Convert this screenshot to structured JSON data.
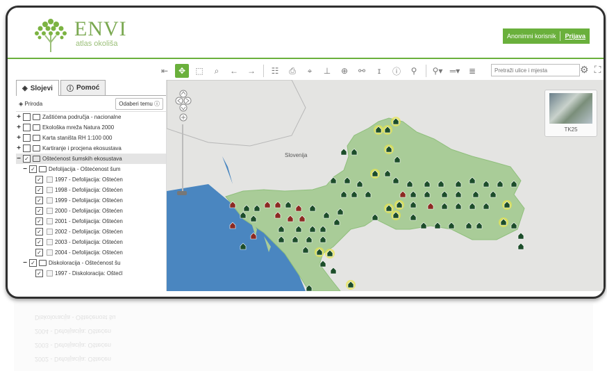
{
  "header": {
    "logo_title": "ENVI",
    "logo_subtitle": "atlas okoliša",
    "user_label": "Anonimni korisnik",
    "login_label": "Prijava"
  },
  "toolbar": {
    "search_placeholder": "Pretraži ulice i mjesta",
    "icons": [
      "exit-icon",
      "pan-icon",
      "zoom-box-icon",
      "identify-icon",
      "back-icon",
      "forward-icon",
      "legend-icon",
      "print-icon",
      "gps-icon",
      "hierarchy-icon",
      "globe-icon",
      "link-icon",
      "info-popup-icon",
      "info-icon",
      "search-icon",
      "marker-icon",
      "line-icon",
      "stack-icon",
      "settings-icon",
      "fullscreen-icon"
    ]
  },
  "sidebar": {
    "tabs": [
      {
        "label": "Slojevi",
        "icon": "layers-icon",
        "active": true
      },
      {
        "label": "Pomoć",
        "icon": "help-icon",
        "active": false
      }
    ],
    "theme_name": "Priroda",
    "theme_button": "Odaberi temu",
    "tree": [
      {
        "level": 0,
        "expander": "+",
        "checked": false,
        "label": "Zaštićena područja - nacionalne",
        "highlight": false
      },
      {
        "level": 0,
        "expander": "+",
        "checked": false,
        "label": "Ekološka mreža Natura 2000",
        "highlight": false
      },
      {
        "level": 0,
        "expander": "+",
        "checked": false,
        "label": "Karta staništa RH 1:100 000",
        "highlight": false
      },
      {
        "level": 0,
        "expander": "+",
        "checked": false,
        "label": "Kartiranje i procjena ekosustava",
        "highlight": false
      },
      {
        "level": 0,
        "expander": "−",
        "checked": true,
        "label": "Oštećenost šumskih ekosustava",
        "highlight": true
      },
      {
        "level": 1,
        "expander": "−",
        "checked": true,
        "label": "Defolijacija - Oštećenost šum",
        "highlight": false
      },
      {
        "level": 2,
        "expander": "",
        "checked": true,
        "label": "1997 - Defolijacija: Oštećen",
        "highlight": false
      },
      {
        "level": 2,
        "expander": "",
        "checked": true,
        "label": "1998 - Defolijacija: Oštećen",
        "highlight": false
      },
      {
        "level": 2,
        "expander": "",
        "checked": true,
        "label": "1999 - Defolijacija: Oštećen",
        "highlight": false
      },
      {
        "level": 2,
        "expander": "",
        "checked": true,
        "label": "2000 - Defolijacija: Oštećen",
        "highlight": false
      },
      {
        "level": 2,
        "expander": "",
        "checked": true,
        "label": "2001 - Defolijacija: Oštećen",
        "highlight": false
      },
      {
        "level": 2,
        "expander": "",
        "checked": true,
        "label": "2002 - Defolijacija: Oštećen",
        "highlight": false
      },
      {
        "level": 2,
        "expander": "",
        "checked": true,
        "label": "2003 - Defolijacija: Oštećen",
        "highlight": false
      },
      {
        "level": 2,
        "expander": "",
        "checked": true,
        "label": "2004 - Defolijacija: Oštećen",
        "highlight": false
      },
      {
        "level": 1,
        "expander": "−",
        "checked": true,
        "label": "Diskoloracija - Oštećenost šu",
        "highlight": false
      },
      {
        "level": 2,
        "expander": "",
        "checked": true,
        "label": "1997 - Diskoloracija: Oštećl",
        "highlight": false
      }
    ]
  },
  "map": {
    "country_label": "Slovenija",
    "thumbnail_label": "TK25",
    "colors": {
      "sea": "#4a86c0",
      "land": "#a9cc98",
      "other_land": "#e4e4e2",
      "marker_dark": "#1c4d2a",
      "marker_red": "#8b2a22",
      "halo": "#e8e54a"
    }
  },
  "reflection": {
    "lines": [
      "Diskoloracija - Oštećenost šu",
      "2004 - Defolijacija: Oštećen",
      "2003 - Defolijacija: Oštećen",
      "2002 - Defolijacija: Oštećen"
    ]
  }
}
